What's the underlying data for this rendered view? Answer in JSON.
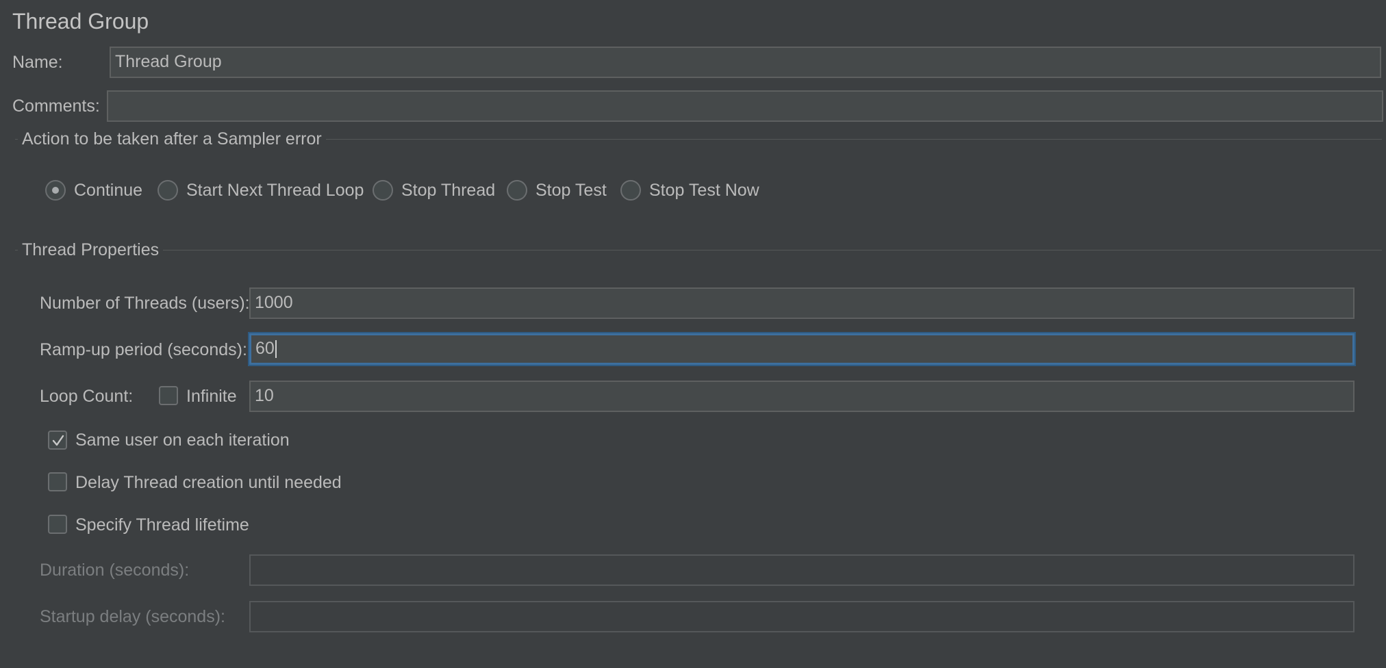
{
  "panel": {
    "title": "Thread Group",
    "name_label": "Name:",
    "name_value": "Thread Group",
    "comments_label": "Comments:",
    "comments_value": ""
  },
  "sampler_error": {
    "group_title": "Action to be taken after a Sampler error",
    "selected": "Continue",
    "options": [
      "Continue",
      "Start Next Thread Loop",
      "Stop Thread",
      "Stop Test",
      "Stop Test Now"
    ]
  },
  "thread_properties": {
    "group_title": "Thread Properties",
    "num_threads_label": "Number of Threads (users):",
    "num_threads_value": "1000",
    "rampup_label": "Ramp-up period (seconds):",
    "rampup_value": "60",
    "loop_count_label": "Loop Count:",
    "infinite_label": "Infinite",
    "infinite_checked": false,
    "loop_count_value": "10",
    "same_user_label": "Same user on each iteration",
    "same_user_checked": true,
    "delay_creation_label": "Delay Thread creation until needed",
    "delay_creation_checked": false,
    "specify_lifetime_label": "Specify Thread lifetime",
    "specify_lifetime_checked": false,
    "duration_label": "Duration (seconds):",
    "duration_value": "",
    "startup_delay_label": "Startup delay (seconds):",
    "startup_delay_value": ""
  },
  "colors": {
    "background": "#3c3f41",
    "field_background": "#45494a",
    "focus_border": "#3d6f9e",
    "text": "#bbbbbb",
    "disabled_text": "#7b7e80"
  }
}
